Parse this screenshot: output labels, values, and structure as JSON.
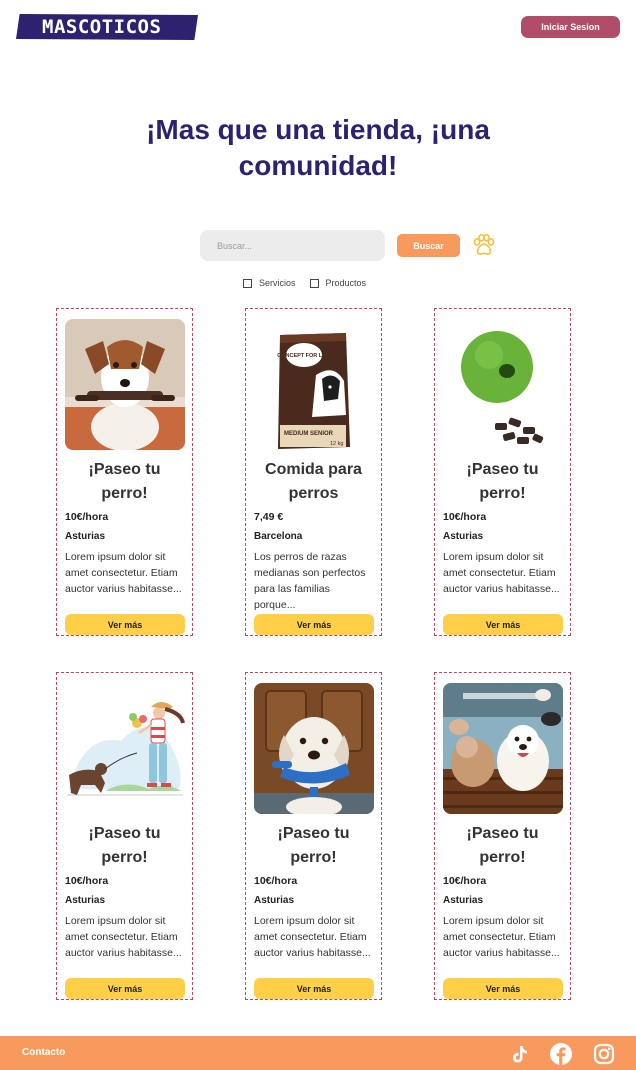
{
  "header": {
    "logo_text": "MASCOTICOS",
    "login_label": "Iniciar Sesion"
  },
  "hero": {
    "headline_line1": "¡Mas que una tienda, ¡una",
    "headline_line2": "comunidad!"
  },
  "search": {
    "placeholder": "Buscar...",
    "button_label": "Buscar",
    "paw_icon": "paw-icon"
  },
  "filters": [
    {
      "label": "Servicios",
      "checked": false
    },
    {
      "label": "Productos",
      "checked": false
    }
  ],
  "cards": [
    {
      "title": "¡Paseo tu perro!",
      "price": "10€/hora",
      "location": "Asturias",
      "description": "Lorem ipsum dolor sit amet consectetur. Etiam auctor varius habitasse...",
      "button": "Ver más",
      "image": "dog-holding-leash-photo"
    },
    {
      "title": "Comida para perros",
      "price": "7,49 €",
      "location": "Barcelona",
      "description": "Los perros de razas medianas son perfectos para las familias porque...",
      "button": "Ver más",
      "image": "dog-food-bag-photo",
      "bag_brand": "CONCEPT FOR LIFE",
      "bag_variant": "MEDIUM SENIOR",
      "bag_weight": "12 kg"
    },
    {
      "title": "¡Paseo tu perro!",
      "price": "10€/hora",
      "location": "Asturias",
      "description": "Lorem ipsum dolor sit amet consectetur. Etiam auctor varius habitasse...",
      "button": "Ver más",
      "image": "green-ball-treats-photo"
    },
    {
      "title": "¡Paseo tu perro!",
      "price": "10€/hora",
      "location": "Asturias",
      "description": "Lorem ipsum dolor sit amet consectetur. Etiam auctor varius habitasse...",
      "button": "Ver más",
      "image": "woman-walking-dog-illustration"
    },
    {
      "title": "¡Paseo tu perro!",
      "price": "10€/hora",
      "location": "Asturias",
      "description": "Lorem ipsum dolor sit amet consectetur. Etiam auctor varius habitasse...",
      "button": "Ver más",
      "image": "labrador-with-leash-photo"
    },
    {
      "title": "¡Paseo tu perro!",
      "price": "10€/hora",
      "location": "Asturias",
      "description": "Lorem ipsum dolor sit amet consectetur. Etiam auctor varius habitasse...",
      "button": "Ver más",
      "image": "dogs-daycare-photo"
    }
  ],
  "footer": {
    "contact_label": "Contacto",
    "social_icons": [
      "tiktok-icon",
      "facebook-icon",
      "instagram-icon"
    ]
  },
  "colors": {
    "brand_dark": "#2d2170",
    "login_button": "#b24d69",
    "accent_orange": "#f89a5e",
    "button_yellow": "#ffd047",
    "card_border": "#b9485f"
  }
}
